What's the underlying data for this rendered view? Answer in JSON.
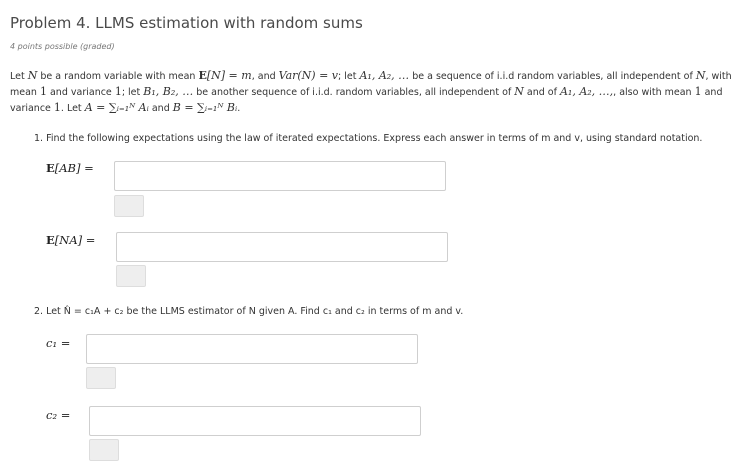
{
  "problem": {
    "title": "Problem 4. LLMS estimation with random sums",
    "points": "4 points possible (graded)",
    "intro": {
      "t1": "Let ",
      "t2": " be a random variable with mean ",
      "t3": ", and ",
      "t4": "; let ",
      "t5": " be a sequence of i.i.d random variables, all independent of ",
      "t6": ", with mean ",
      "t7": " and variance ",
      "t8": "; let ",
      "t9": " be another sequence of i.i.d. random variables, all independent of ",
      "t10": " and of ",
      "t11": ", also with mean ",
      "t12": " and variance ",
      "t13": ". Let ",
      "t14": " and ",
      "t15": "."
    }
  },
  "math": {
    "N": "N",
    "EN": "E",
    "EN_rest": "[N] = m",
    "Var": "Var(N) = v",
    "Aseq": "A₁, A₂, …",
    "one": "1",
    "Bseq": "B₁, B₂, …",
    "Aseq2": "A₁, A₂, …,",
    "Adef": "A = ∑ᵢ₌₁ᴺ Aᵢ",
    "Bdef": "B = ∑ᵢ₌₁ᴺ Bᵢ"
  },
  "q1": {
    "text": "1. Find the following expectations using the law of iterated expectations. Express each answer in terms of m and v, using standard notation.",
    "label_eab_E": "E",
    "label_eab_rest": "[AB] =",
    "label_ena_E": "E",
    "label_ena_rest": "[NA] ="
  },
  "q2": {
    "text": "2. Let N̂ = c₁A + c₂ be the LLMS estimator of N given A. Find c₁ and c₂ in terms of m and v.",
    "label_c1": "c₁ =",
    "label_c2": "c₂ ="
  }
}
